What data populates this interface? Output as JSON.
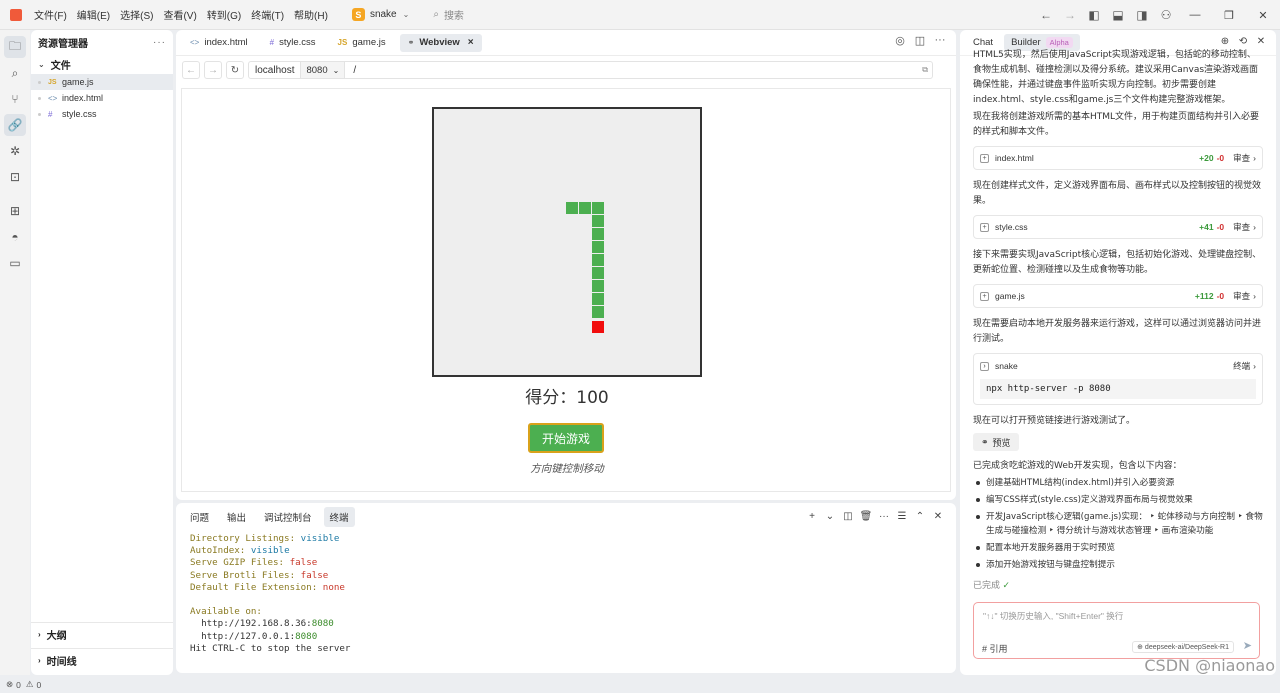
{
  "titlebar": {
    "menus": [
      "文件(F)",
      "编辑(E)",
      "选择(S)",
      "查看(V)",
      "转到(G)",
      "终端(T)",
      "帮助(H)"
    ],
    "project_badge": "S",
    "project_name": "snake",
    "search_placeholder": "搜索"
  },
  "sidebar": {
    "title": "资源管理器",
    "more": "···",
    "section": "文件",
    "files": [
      {
        "name": "game.js",
        "type": "JS"
      },
      {
        "name": "index.html",
        "type": "<>"
      },
      {
        "name": "style.css",
        "type": "#"
      }
    ],
    "outline": "大纲",
    "timeline": "时间线"
  },
  "editor": {
    "tabs": [
      {
        "label": "index.html",
        "icon": "<>"
      },
      {
        "label": "style.css",
        "icon": "#"
      },
      {
        "label": "game.js",
        "icon": "JS"
      },
      {
        "label": "Webview",
        "icon": "🔗"
      }
    ],
    "address": {
      "host": "localhost",
      "port": "8080",
      "path": "/"
    }
  },
  "game": {
    "score_label": "得分：100",
    "start_button": "开始游戏",
    "hint": "方向键控制移动",
    "colors": {
      "snake": "#4caf50",
      "food": "#f10d0d",
      "board": "#eeeeee"
    }
  },
  "panel": {
    "tabs": [
      "问题",
      "输出",
      "调试控制台",
      "终端"
    ],
    "terminal": {
      "dir_listings_k": "Directory Listings:",
      "dir_listings_v": "visible",
      "autoindex_k": "AutoIndex:",
      "autoindex_v": "visible",
      "gzip_k": "Serve GZIP Files:",
      "gzip_v": "false",
      "brotli_k": "Serve Brotli Files:",
      "brotli_v": "false",
      "default_ext_k": "Default File Extension:",
      "default_ext_v": "none",
      "available_on": "Available on:",
      "url1_host": "  http://192.168.8.36:",
      "url1_port": "8080",
      "url2_host": "  http://127.0.0.1:",
      "url2_port": "8080",
      "stop": "Hit CTRL-C to stop the server"
    }
  },
  "chat": {
    "tabs": {
      "chat": "Chat",
      "builder": "Builder",
      "alpha": "Alpha"
    },
    "intro_cut": "HTML5实现，然后使用JavaScript实现游戏逻辑，包括蛇的移动控制、食物生成机制、碰撞检测以及得分系统。建议采用Canvas渲染游戏画面确保性能，并通过键盘事件监听实现方向控制。初步需要创建index.html、style.css和game.js三个文件构建完整游戏框架。",
    "p1": "现在我将创建游戏所需的基本HTML文件，用于构建页面结构并引入必要的样式和脚本文件。",
    "card1": {
      "name": "index.html",
      "plus": "+20",
      "minus": "-0",
      "review": "审查"
    },
    "p2": "现在创建样式文件，定义游戏界面布局、画布样式以及控制按钮的视觉效果。",
    "card2": {
      "name": "style.css",
      "plus": "+41",
      "minus": "-0",
      "review": "审查"
    },
    "p3": "接下来需要实现JavaScript核心逻辑，包括初始化游戏、处理键盘控制、更新蛇位置、检测碰撞以及生成食物等功能。",
    "card3": {
      "name": "game.js",
      "plus": "+112",
      "minus": "-0",
      "review": "审查"
    },
    "p4": "现在需要启动本地开发服务器来运行游戏，这样可以通过浏览器访问并进行测试。",
    "termcard": {
      "name": "snake",
      "action": "终端",
      "command": "npx http-server -p 8080"
    },
    "p5": "现在可以打开预览链接进行游戏测试了。",
    "preview": "预览",
    "p6": "已完成贪吃蛇游戏的Web开发实现，包含以下内容：",
    "bullets": [
      "创建基础HTML结构(index.html)并引入必要资源",
      "编写CSS样式(style.css)定义游戏界面布局与视觉效果",
      "开发JavaScript核心逻辑(game.js)实现： ‣ 蛇体移动与方向控制 ‣ 食物生成与碰撞检测 ‣ 得分统计与游戏状态管理 ‣ 画布渲染功能",
      "配置本地开发服务器用于实时预览",
      "添加开始游戏按钮与键盘控制提示"
    ],
    "done": "已完成",
    "input_placeholder": "\"↑↓\" 切换历史输入, \"Shift+Enter\" 换行",
    "ref": "# 引用",
    "model": "⊕ deepseek-ai/DeepSeek-R1"
  },
  "statusbar": {
    "errors": "0",
    "warnings": "0"
  },
  "watermark": "CSDN @niaonao"
}
